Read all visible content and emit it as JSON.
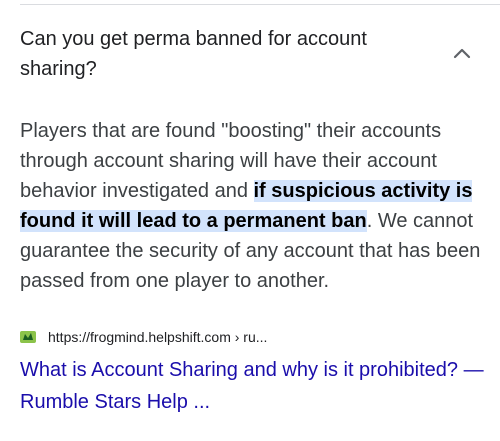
{
  "faq": {
    "question": "Can you get perma banned for account sharing?",
    "chevron_icon": "chevron-up-icon",
    "answer_before": "Players that are found \"boosting\" their accounts through account sharing will have their account behavior investigated and ",
    "answer_highlight": "if suspicious activity is found it will lead to a permanent ban",
    "answer_after": ". We cannot guarantee the security of any account that has been passed from one player to another."
  },
  "source": {
    "favicon_icon": "rumble-stars-favicon-icon",
    "url": "https://frogmind.helpshift.com › ru...",
    "link_title": "What is Account Sharing and why is it prohibited? — Rumble Stars Help ..."
  },
  "colors": {
    "link": "#1a0dab",
    "highlight": "#d2e3fc",
    "text": "#202124",
    "favicon": "#8bc34a"
  }
}
